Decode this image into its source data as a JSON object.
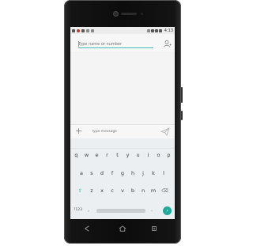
{
  "status_bar": {
    "time": "4:13",
    "left_icons": [
      "notification-icon",
      "alert-icon",
      "message-icon",
      "lock-icon",
      "image-icon"
    ],
    "right_icons": [
      "vibrate-icon",
      "wifi-icon",
      "signal-icon",
      "battery-icon"
    ]
  },
  "recipient": {
    "placeholder": "Type name or number",
    "add_contact_icon": "add-contact-icon"
  },
  "compose": {
    "placeholder": "Type message",
    "attach_icon_glyph": "+",
    "send_icon": "send-icon"
  },
  "keyboard": {
    "row1": [
      "q",
      "w",
      "e",
      "r",
      "t",
      "y",
      "u",
      "i",
      "o",
      "p"
    ],
    "row2": [
      "a",
      "s",
      "d",
      "f",
      "g",
      "h",
      "j",
      "k",
      "l"
    ],
    "row3": [
      "z",
      "x",
      "c",
      "v",
      "b",
      "n",
      "m"
    ],
    "shift_glyph": "⇧",
    "backspace_glyph": "⌫",
    "symbols_label": "?123",
    "comma_label": ",",
    "period_label": ".",
    "enter_glyph": "›"
  },
  "colors": {
    "accent": "#41bfb3",
    "enter_button": "#21a99a",
    "screen_bg": "#f4f4f4",
    "keyboard_bg": "#eceff1",
    "phone_body": "#111111"
  }
}
